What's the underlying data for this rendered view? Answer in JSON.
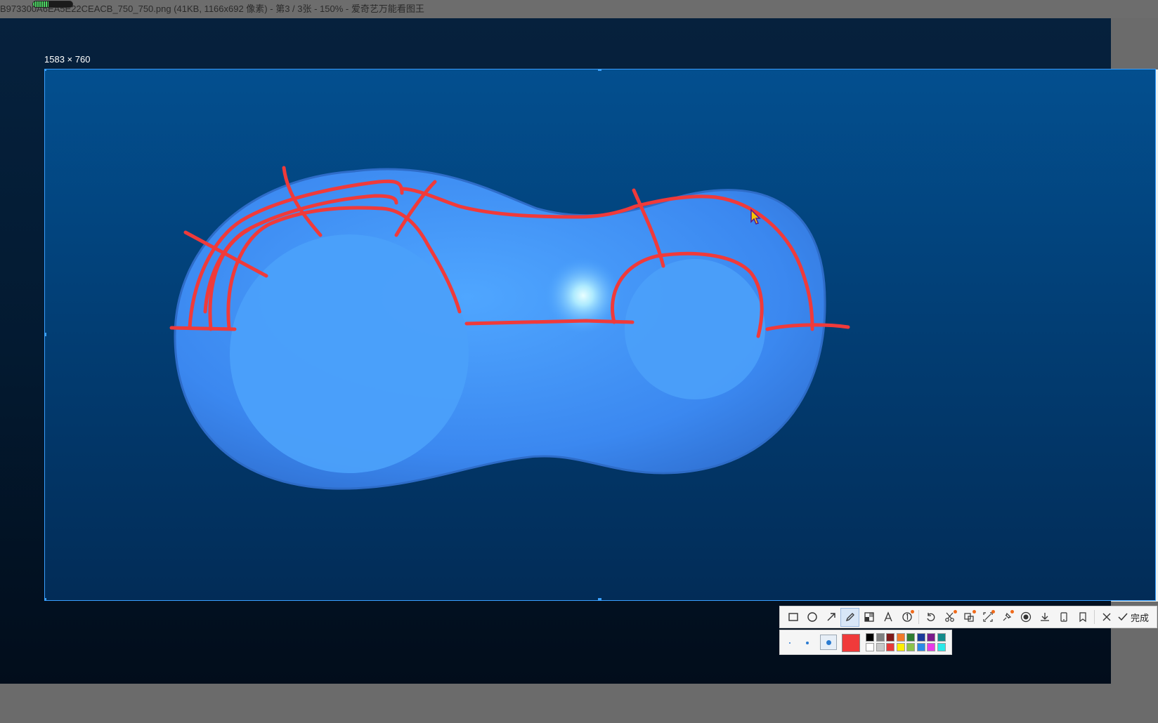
{
  "window": {
    "title": "B973300A6EA5E22CEACB_750_750.png (41KB, 1166x692 像素) - 第3 / 3张 - 150% - 爱奇艺万能看图王"
  },
  "selection": {
    "dimensions_label": "1583 × 760"
  },
  "toolbar": {
    "tools": [
      {
        "name": "rectangle-tool",
        "icon": "rectangle-icon"
      },
      {
        "name": "ellipse-tool",
        "icon": "circle-icon"
      },
      {
        "name": "arrow-tool",
        "icon": "arrow-icon"
      },
      {
        "name": "pen-tool",
        "icon": "pencil-icon",
        "active": true
      },
      {
        "name": "mosaic-tool",
        "icon": "mosaic-icon"
      },
      {
        "name": "text-tool",
        "icon": "text-icon"
      },
      {
        "name": "number-tool",
        "icon": "numbered-circle-icon"
      },
      {
        "name": "undo-tool",
        "icon": "undo-icon"
      },
      {
        "name": "scissors-tool",
        "icon": "scissors-icon"
      },
      {
        "name": "translate-tool",
        "icon": "translate-icon"
      },
      {
        "name": "scan-tool",
        "icon": "scan-icon"
      },
      {
        "name": "pin-tool",
        "icon": "pin-icon"
      },
      {
        "name": "record-tool",
        "icon": "record-icon"
      },
      {
        "name": "download-tool",
        "icon": "download-icon"
      },
      {
        "name": "phone-tool",
        "icon": "phone-icon"
      },
      {
        "name": "bookmark-tool",
        "icon": "bookmark-icon"
      }
    ],
    "close_icon": "close-icon",
    "done_label": "完成"
  },
  "palette": {
    "current_color": "#f03a3a",
    "brush_sizes": [
      "small",
      "medium",
      "large"
    ],
    "selected_size": "large",
    "row1": [
      "#000000",
      "#7f7f7f",
      "#7f1a1a",
      "#f07a2a",
      "#2e7d32",
      "#1a3a9a",
      "#7a1a8a",
      "#138a8a"
    ],
    "row2": [
      "#ffffff",
      "#c8c8c8",
      "#e83a3a",
      "#ffee00",
      "#8bc34a",
      "#2a8ae8",
      "#e83ae8",
      "#2ae8e8"
    ]
  },
  "colors": {
    "accent": "#3aa0ff",
    "annotation_red": "#f03a3a"
  }
}
